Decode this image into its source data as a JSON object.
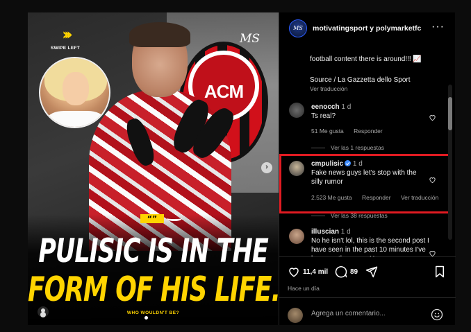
{
  "post": {
    "overlay": {
      "swipe_label": "SWIPE LEFT",
      "brand_mark": "MS",
      "crest_text": "ACM",
      "quote_mark": "“”",
      "headline_line1": "PULISIC IS IN THE",
      "headline_line2": "FORM OF HIS LIFE...",
      "subline": "WHO WOULDN'T BE?"
    }
  },
  "header": {
    "owner": "motivatingsport y polymarketfc",
    "more_icon": "more-dots-icon"
  },
  "caption": {
    "line1": "football content there is around!!! 📈",
    "line2": "Source / La Gazzetta dello Sport",
    "translate": "Ver traducción"
  },
  "comments": [
    {
      "user": "eenocch",
      "time": "1 d",
      "text": "Ts real?",
      "likes": "51 Me gusta",
      "reply": "Responder",
      "replies": "Ver las 1 respuestas"
    },
    {
      "user": "cmpulisic",
      "verified": true,
      "time": "1 d",
      "text": "Fake news guys let’s stop with the silly rumor",
      "likes": "2.523 Me gusta",
      "reply": "Responder",
      "translate": "Ver traducción",
      "replies": "Ver las 38 respuestas"
    },
    {
      "user": "illuscian",
      "time": "1 d",
      "text": "No he isn't lol, this is the second post I have seen in the past 10 minutes I've been on the gram. He"
    }
  ],
  "actions": {
    "likes_count": "11,4 mil",
    "comments_count": "89",
    "posted_ago": "Hace un día"
  },
  "composer": {
    "placeholder": "Agrega un comentario..."
  },
  "colors": {
    "highlight_border": "#e11b22",
    "verified": "#3d8bfd",
    "accent_yellow": "#ffd400"
  }
}
